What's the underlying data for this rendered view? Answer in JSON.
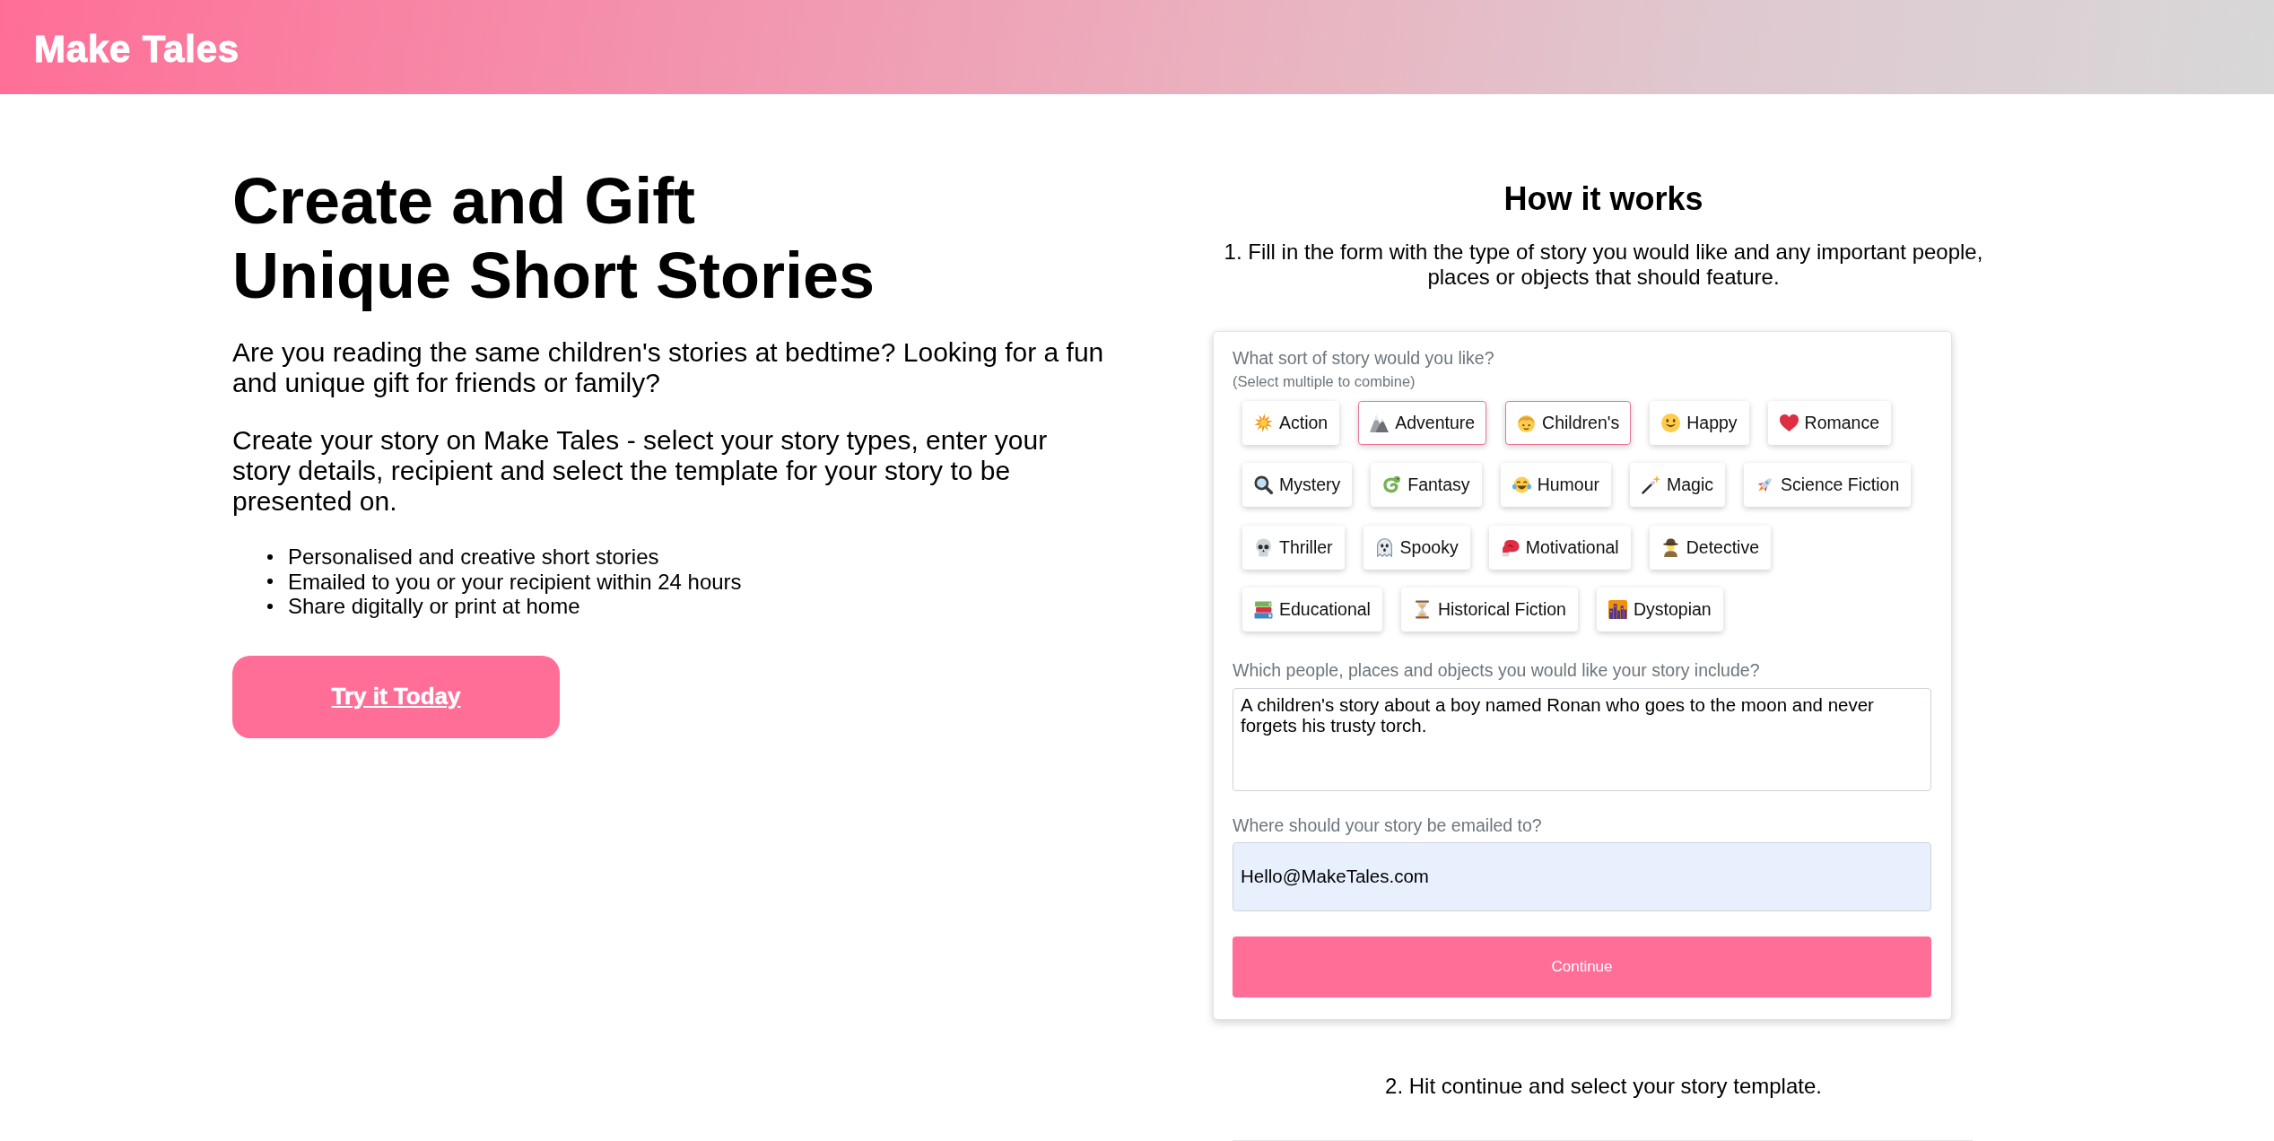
{
  "header": {
    "logo": "Make Tales"
  },
  "hero": {
    "title_lines": [
      "Create and Gift",
      "Unique Short Stories"
    ],
    "paragraphs": [
      "Are you reading the same children's stories at bedtime? Looking for a fun and unique gift for friends or family?",
      "Create your story on Make Tales - select your story types, enter your story details, recipient and select the template for your story to be presented on."
    ],
    "features": [
      "Personalised and creative short stories",
      "Emailed to you or your recipient within 24 hours",
      "Share digitally or print at home"
    ],
    "cta": "Try it Today"
  },
  "how_it_works": {
    "title": "How it works",
    "step_1": "1. Fill in the form with the type of story you would like and any important people, places or objects that should feature.",
    "form": {
      "story_type_label": "What sort of story would you like?",
      "story_type_hint": "(Select multiple to combine)",
      "story_types": [
        {
          "label": "Action",
          "selected": false
        },
        {
          "label": "Adventure",
          "selected": true
        },
        {
          "label": "Children's",
          "selected": true
        },
        {
          "label": "Happy",
          "selected": false
        },
        {
          "label": "Romance",
          "selected": false
        },
        {
          "label": "Mystery",
          "selected": false
        },
        {
          "label": "Fantasy",
          "selected": false
        },
        {
          "label": "Humour",
          "selected": false
        },
        {
          "label": "Magic",
          "selected": false
        },
        {
          "label": "Science Fiction",
          "selected": false
        },
        {
          "label": "Thriller",
          "selected": false
        },
        {
          "label": "Spooky",
          "selected": false
        },
        {
          "label": "Motivational",
          "selected": false
        },
        {
          "label": "Detective",
          "selected": false
        },
        {
          "label": "Educational",
          "selected": false
        },
        {
          "label": "Historical Fiction",
          "selected": false
        },
        {
          "label": "Dystopian",
          "selected": false
        }
      ],
      "details_label": "Which people, places and objects you would like your story include?",
      "details": {
        "value": "A children's story about a boy named Ronan who goes to the moon and never forgets his trusty torch."
      },
      "email_label": "Where should your story be emailed to?",
      "email": {
        "value": "Hello@MakeTales.com",
        "autofilled": true
      },
      "submit": "Continue"
    },
    "step_2": "2. Hit continue and select your story template."
  }
}
